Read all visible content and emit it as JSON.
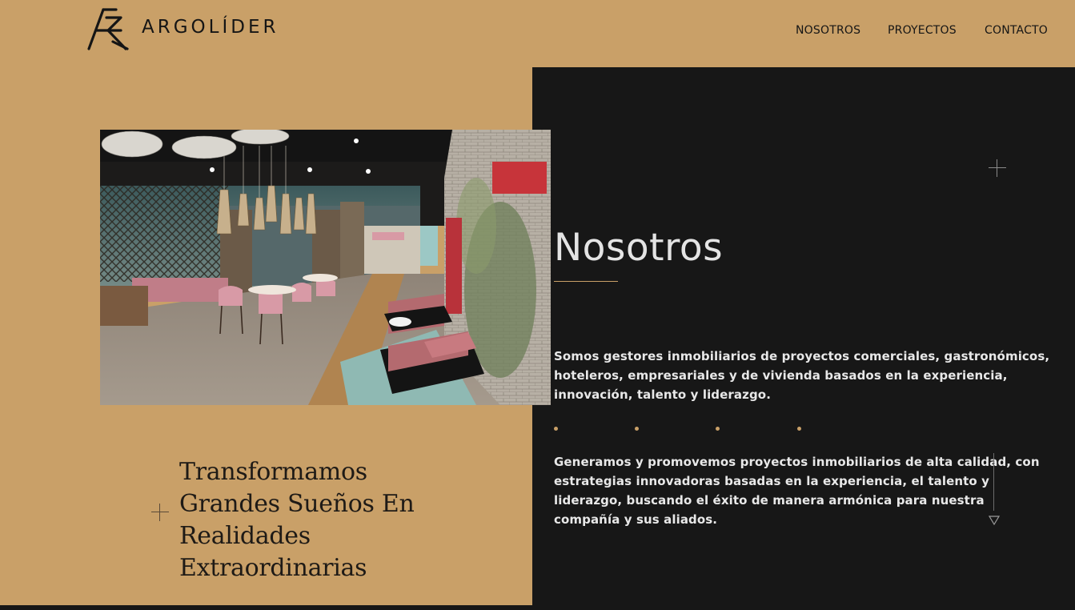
{
  "brand": {
    "name": "ARGOLÍDER"
  },
  "nav": {
    "items": [
      "NOSOTROS",
      "PROYECTOS",
      "CONTACTO"
    ]
  },
  "about": {
    "title": "Nosotros",
    "paragraph1": "Somos gestores inmobiliarios de proyectos comerciales, gastronómicos, hoteleros, empresariales y de vivienda basados en la experiencia, innovación, talento y liderazgo.",
    "paragraph2": "Generamos y promovemos proyectos inmobiliarios de alta calidad, con estrategias innovadoras basadas en la experiencia, el talento y liderazgo, buscando el éxito de manera armónica para nuestra compañía y sus aliados."
  },
  "hero": {
    "tagline": "Transformamos Grandes Sueños En Realidades Extraordinarias"
  },
  "icons": {
    "logo": "argolider-logo-icon",
    "plus": "plus-icon",
    "scroll": "scroll-down-arrow-icon"
  },
  "colors": {
    "accent": "#c9a068",
    "dark": "#171717",
    "text_light": "#e8e8e8"
  }
}
